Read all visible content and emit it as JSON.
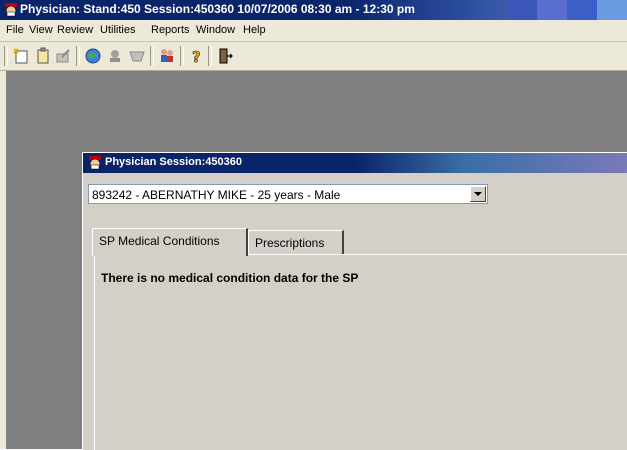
{
  "app": {
    "title": "Physician: Stand:450 Session:450360 10/07/2006 08:30 am - 12:30 pm"
  },
  "menu": [
    "File",
    "View",
    "Review",
    "Utilities",
    "Reports",
    "Window",
    "Help"
  ],
  "toolbar": {
    "icons": [
      "new-icon",
      "clipboard-icon",
      "edit-icon",
      "globe-icon",
      "stamp-icon",
      "form-icon",
      "people-icon",
      "help-icon",
      "exit-icon"
    ]
  },
  "session_window": {
    "title": "Physician Session:450360",
    "participant_select": {
      "value": "893242 - ABERNATHY MIKE - 25  years  - Male"
    },
    "tabs": [
      {
        "label": "SP Medical Conditions",
        "active": true
      },
      {
        "label": "Prescriptions",
        "active": false
      }
    ],
    "message": "There is no medical condition data for the SP"
  }
}
